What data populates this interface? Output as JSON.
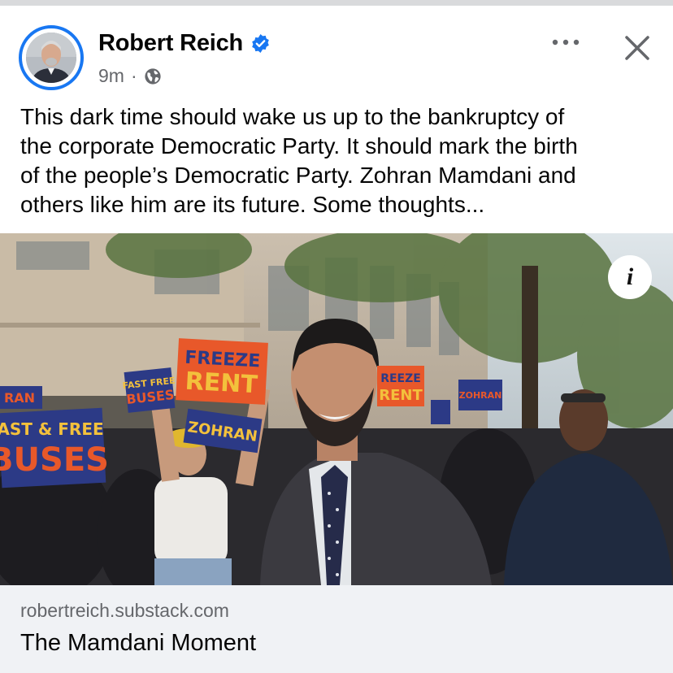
{
  "author": {
    "name": "Robert Reich",
    "verified_icon": "verified-badge-icon"
  },
  "meta": {
    "time": "9m",
    "separator": "·",
    "audience_icon": "globe-icon"
  },
  "actions": {
    "more_icon": "more-horizontal-icon",
    "close_icon": "close-icon"
  },
  "post": {
    "lines": [
      "This dark time should wake us up to the bankruptcy of",
      "the corporate Democratic Party. It should mark the birth",
      "of the people’s Democratic Party. Zohran Mamdani and",
      "others like him are its future. Some thoughts..."
    ]
  },
  "image": {
    "info_label": "i",
    "signs": {
      "freeze_rent": [
        "FREEZE",
        "RENT"
      ],
      "freeze_rent_small": [
        "REEZE",
        "RENT"
      ],
      "fast_free_buses": [
        "AST & FREE",
        "BUSES"
      ],
      "fast_free_small": [
        "FAST FREE",
        "BUSES"
      ],
      "zohran": "ZOHRAN",
      "zohran_left": "RAN",
      "zohran_small": "ZOHRAN"
    }
  },
  "link": {
    "domain": "robertreich.substack.com",
    "title": "The Mamdani Moment"
  },
  "colors": {
    "brand_blue": "#1877f2",
    "sign_orange": "#e8582a",
    "sign_navy": "#2c3a86",
    "sign_yellow": "#f3c13c"
  }
}
